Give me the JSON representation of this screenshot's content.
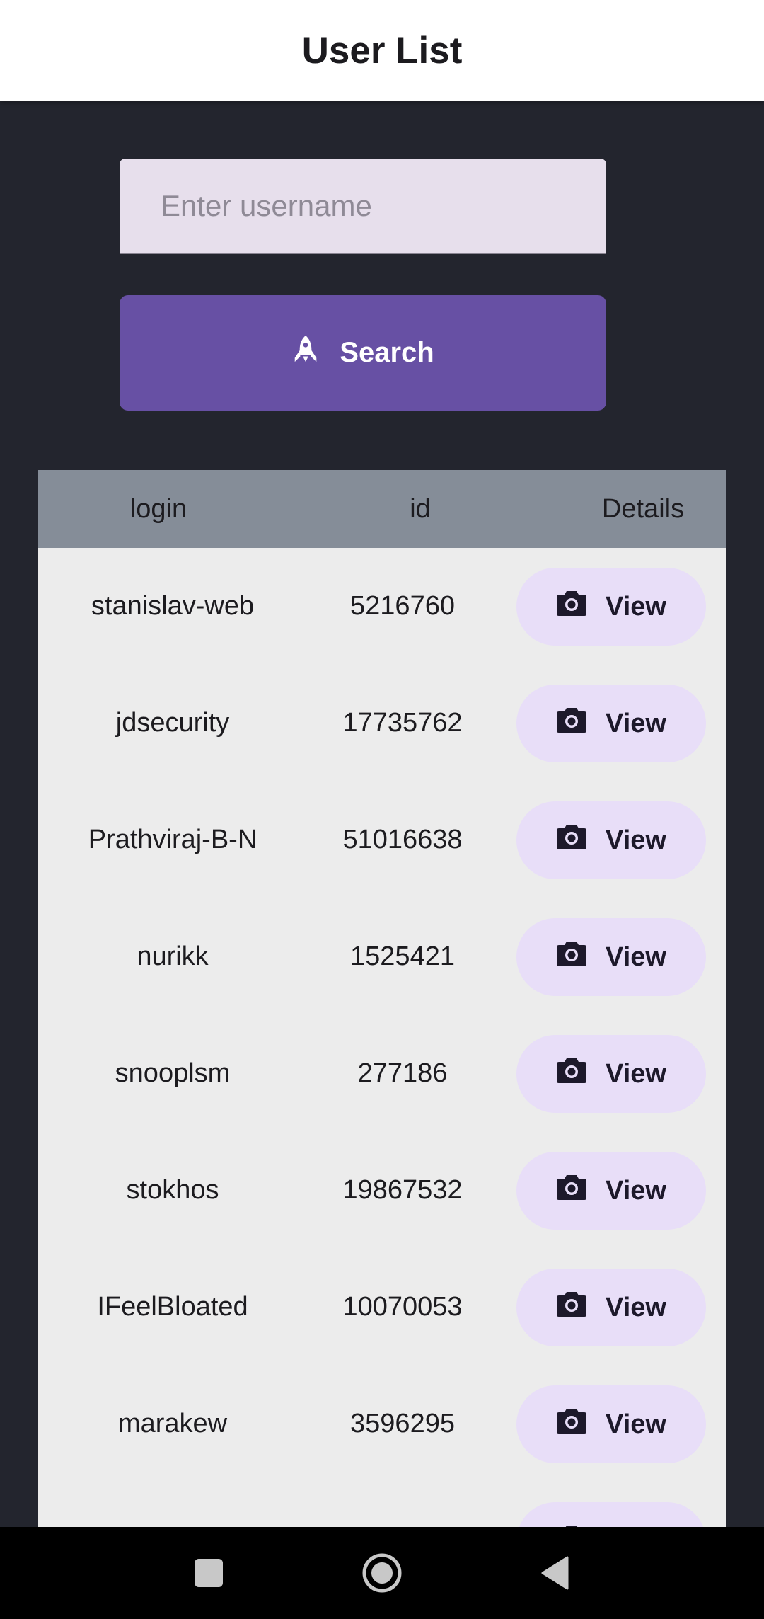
{
  "app_bar": {
    "title": "User List"
  },
  "search": {
    "placeholder": "Enter username",
    "value": "",
    "button_label": "Search",
    "button_icon": "rocket-icon"
  },
  "table": {
    "headers": {
      "login": "login",
      "id": "id",
      "details": "Details"
    },
    "view_label": "View",
    "view_icon": "camera-icon",
    "rows": [
      {
        "login": "stanislav-web",
        "id": "5216760"
      },
      {
        "login": "jdsecurity",
        "id": "17735762"
      },
      {
        "login": "Prathviraj-B-N",
        "id": "51016638"
      },
      {
        "login": "nurikk",
        "id": "1525421"
      },
      {
        "login": "snooplsm",
        "id": "277186"
      },
      {
        "login": "stokhos",
        "id": "19867532"
      },
      {
        "login": "IFeelBloated",
        "id": "10070053"
      },
      {
        "login": "marakew",
        "id": "3596295"
      },
      {
        "login": "",
        "id": ""
      }
    ]
  },
  "colors": {
    "background": "#23252e",
    "primary": "#6750a4",
    "input_bg": "#e7dfec",
    "header_bg": "#858d98",
    "table_bg": "#ececec",
    "view_button_bg": "#e8def8"
  },
  "nav_bar": {
    "icons": [
      "recents-square-icon",
      "home-circle-icon",
      "back-triangle-icon"
    ]
  }
}
